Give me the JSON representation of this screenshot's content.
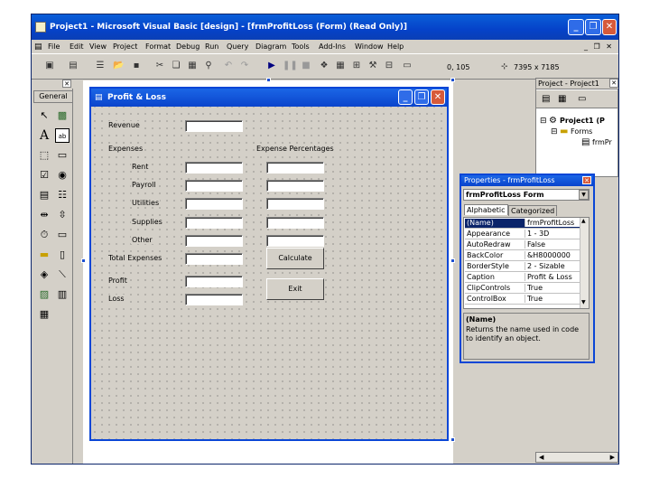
{
  "window": {
    "title": "Project1 - Microsoft Visual Basic [design] - [frmProfitLoss (Form)  (Read Only)]",
    "min_glyph": "_",
    "restore_glyph": "❐",
    "close_glyph": "✕",
    "mdi_controls": "_ ❐ ✕"
  },
  "menu": [
    "File",
    "Edit",
    "View",
    "Project",
    "Format",
    "Debug",
    "Run",
    "Query",
    "Diagram",
    "Tools",
    "Add-Ins",
    "Window",
    "Help"
  ],
  "toolbar": {
    "coords": "0, 105",
    "size_label": "7395 x 7185"
  },
  "toolbox": {
    "title": "General",
    "close_glyph": "✕"
  },
  "form": {
    "title": "Profit & Loss",
    "labels": {
      "revenue": "Revenue",
      "expenses": "Expenses",
      "rent": "Rent",
      "payroll": "Payroll",
      "utilities": "Utilities",
      "supplies": "Supplies",
      "other": "Other",
      "total_expenses": "Total Expenses",
      "profit": "Profit",
      "loss": "Loss",
      "expense_percentages": "Expense Percentages"
    },
    "buttons": {
      "calculate": "Calculate",
      "exit": "Exit"
    }
  },
  "project_explorer": {
    "title": "Project - Project1",
    "root": "Project1 (P",
    "forms_folder": "Forms",
    "form_item": "frmPr"
  },
  "properties": {
    "title": "Properties - frmProfitLoss",
    "object": "frmProfitLoss  Form",
    "tabs": [
      "Alphabetic",
      "Categorized"
    ],
    "rows": [
      {
        "name": "(Name)",
        "value": "frmProfitLoss"
      },
      {
        "name": "Appearance",
        "value": "1 - 3D"
      },
      {
        "name": "AutoRedraw",
        "value": "False"
      },
      {
        "name": "BackColor",
        "value": "&H8000000"
      },
      {
        "name": "BorderStyle",
        "value": "2 - Sizable"
      },
      {
        "name": "Caption",
        "value": "Profit & Loss"
      },
      {
        "name": "ClipControls",
        "value": "True"
      },
      {
        "name": "ControlBox",
        "value": "True"
      }
    ],
    "desc_title": "(Name)",
    "desc_text": "Returns the name used in code to identify an object."
  }
}
